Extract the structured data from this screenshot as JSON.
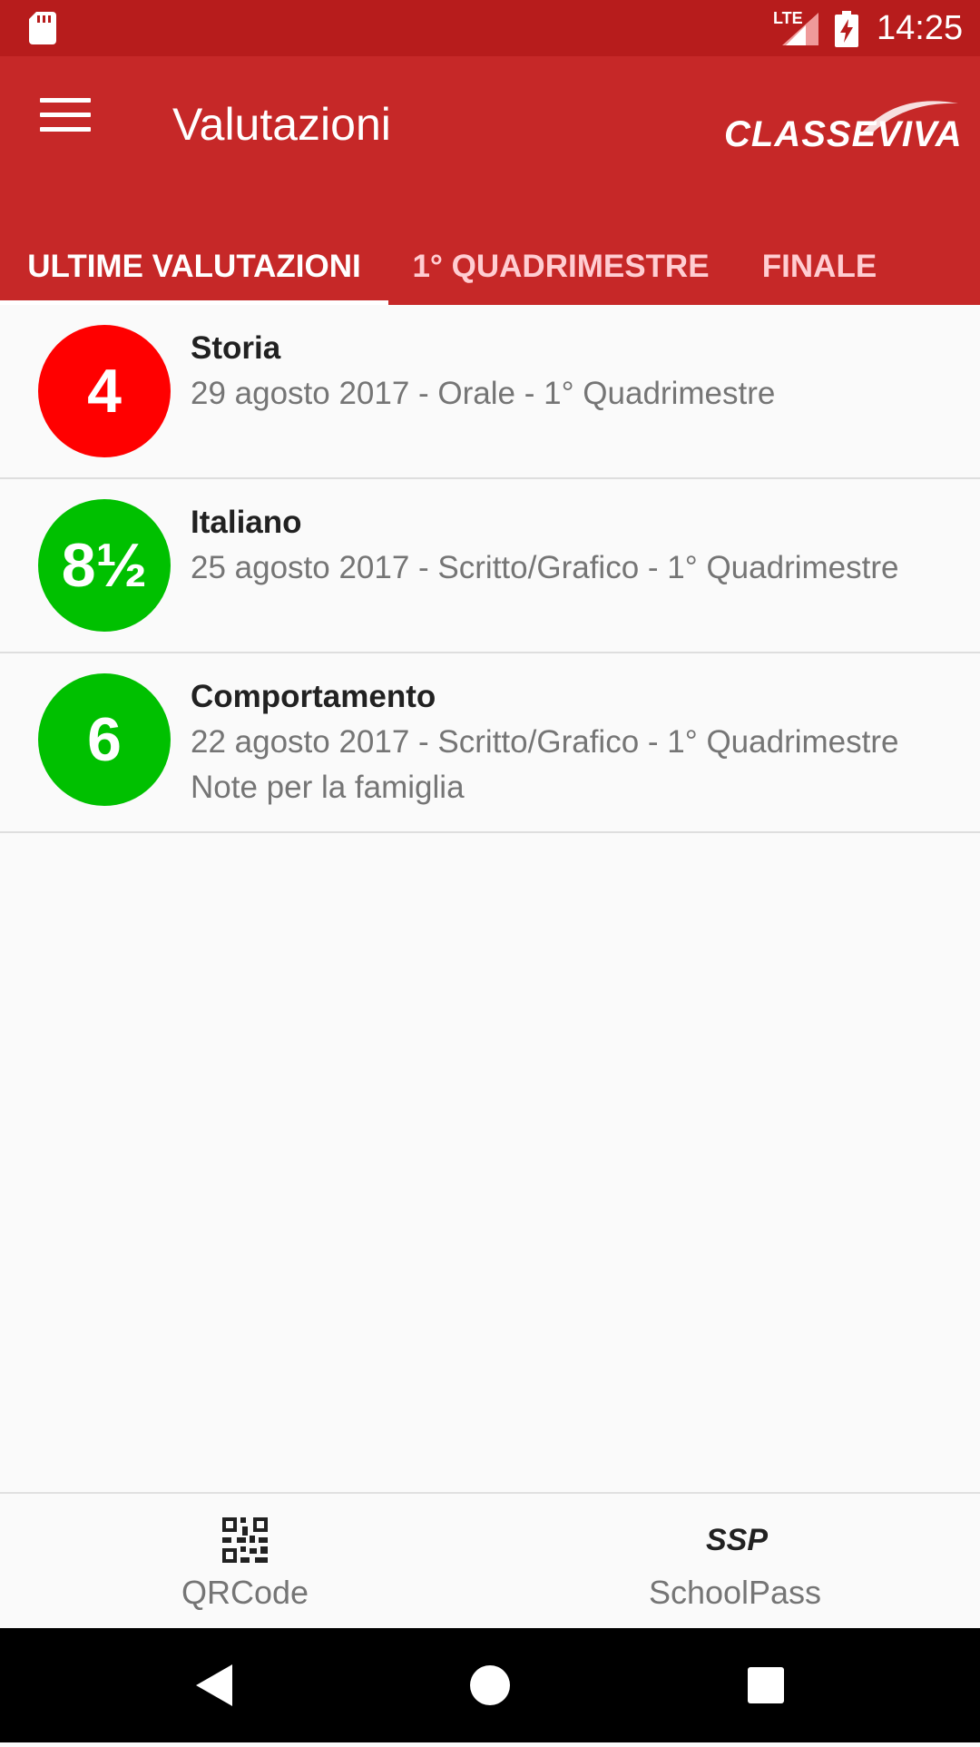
{
  "status_bar": {
    "network": "LTE",
    "time": "14:25"
  },
  "app_bar": {
    "title": "Valutazioni",
    "brand": "CLASSEVIVA",
    "menu_icon": "menu-icon"
  },
  "tabs": [
    {
      "label": "ULTIME VALUTAZIONI",
      "active": true
    },
    {
      "label": "1° QUADRIMESTRE",
      "active": false
    },
    {
      "label": "FINALE",
      "active": false
    }
  ],
  "grades": [
    {
      "grade": "4",
      "color": "#ff0000",
      "subject": "Storia",
      "detail": "29 agosto 2017 - Orale - 1° Quadrimestre",
      "note": ""
    },
    {
      "grade": "8½",
      "color": "#00c000",
      "subject": "Italiano",
      "detail": "25 agosto 2017 - Scritto/Grafico - 1° Quadrimestre",
      "note": ""
    },
    {
      "grade": "6",
      "color": "#00c000",
      "subject": "Comportamento",
      "detail": "22 agosto 2017 - Scritto/Grafico - 1° Quadrimestre",
      "note": "Note per la famiglia"
    }
  ],
  "bottom_bar": [
    {
      "label": "QRCode",
      "icon": "qrcode-icon"
    },
    {
      "label": "SchoolPass",
      "icon": "schoolpass-icon",
      "icon_text": "SSP"
    }
  ],
  "colors": {
    "status_bar": "#b71c1c",
    "app_bar": "#c62828",
    "grade_red": "#ff0000",
    "grade_green": "#00c000"
  }
}
